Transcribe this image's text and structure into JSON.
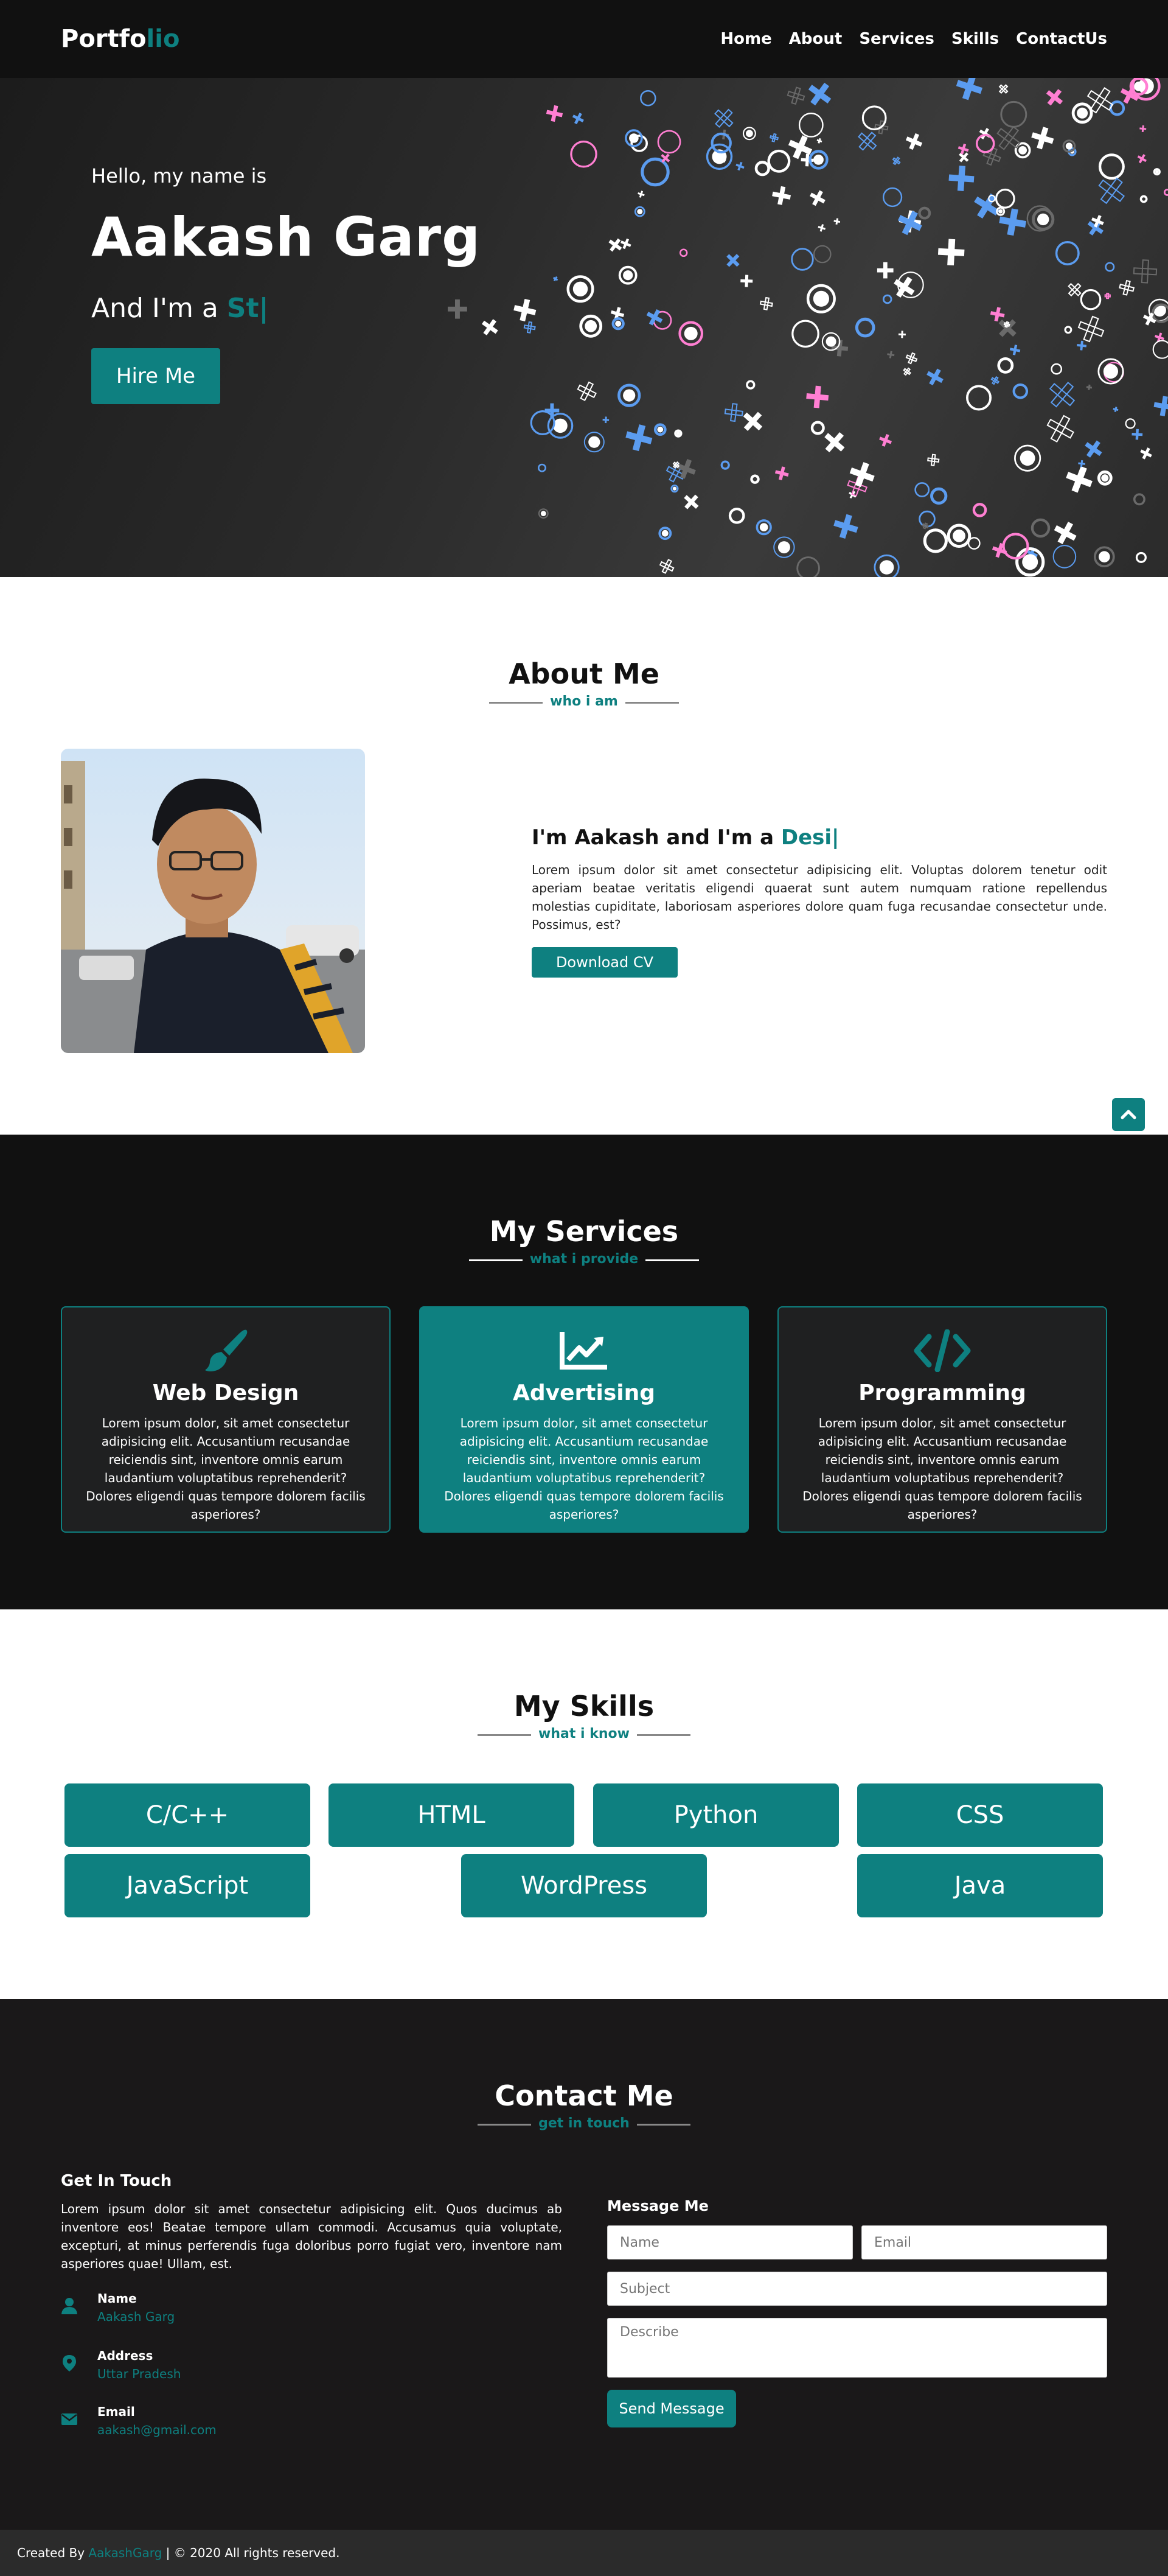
{
  "nav": {
    "logo_main": "Portfo",
    "logo_accent": "lio",
    "items": [
      "Home",
      "About",
      "Services",
      "Skills",
      "ContactUs"
    ]
  },
  "hero": {
    "greeting": "Hello, my name is",
    "name": "Aakash Garg",
    "role_prefix": "And I'm a ",
    "role_typed": "St|",
    "button": "Hire Me"
  },
  "about": {
    "title": "About Me",
    "subtitle": "who i am",
    "heading_prefix": "I'm Aakash and I'm a ",
    "heading_typed": "Desi|",
    "paragraph": "Lorem ipsum dolor sit amet consectetur adipisicing elit. Voluptas dolorem tenetur odit aperiam beatae veritatis eligendi quaerat sunt autem numquam ratione repellendus molestias cupiditate, laboriosam asperiores dolore quam fuga recusandae consectetur unde. Possimus, est?",
    "button": "Download CV"
  },
  "services": {
    "title": "My Services",
    "subtitle": "what i provide",
    "cards": [
      {
        "icon": "paint-brush-icon",
        "title": "Web Design",
        "text": "Lorem ipsum dolor, sit amet consectetur adipisicing elit. Accusantium recusandae reiciendis sint, inventore omnis earum laudantium voluptatibus reprehenderit? Dolores eligendi quas tempore dolorem facilis asperiores?"
      },
      {
        "icon": "chart-line-icon",
        "title": "Advertising",
        "text": "Lorem ipsum dolor, sit amet consectetur adipisicing elit. Accusantium recusandae reiciendis sint, inventore omnis earum laudantium voluptatibus reprehenderit? Dolores eligendi quas tempore dolorem facilis asperiores?"
      },
      {
        "icon": "code-icon",
        "title": "Programming",
        "text": "Lorem ipsum dolor, sit amet consectetur adipisicing elit. Accusantium recusandae reiciendis sint, inventore omnis earum laudantium voluptatibus reprehenderit? Dolores eligendi quas tempore dolorem facilis asperiores?"
      }
    ]
  },
  "skills": {
    "title": "My Skills",
    "subtitle": "what i know",
    "items": [
      "C/C++",
      "HTML",
      "Python",
      "CSS",
      "JavaScript",
      "WordPress",
      "Java"
    ]
  },
  "contact": {
    "title": "Contact Me",
    "subtitle": "get in touch",
    "get_in_touch_title": "Get In Touch",
    "paragraph": "Lorem ipsum dolor sit amet consectetur adipisicing elit. Quos ducimus ab inventore eos! Beatae tempore ullam commodi. Accusamus quia voluptate, excepturi, at minus perferendis fuga doloribus porro fugiat vero, inventore nam asperiores quae! Ullam, est.",
    "info": [
      {
        "icon": "user-icon",
        "label": "Name",
        "value": "Aakash Garg"
      },
      {
        "icon": "map-marker-icon",
        "label": "Address",
        "value": "Uttar Pradesh"
      },
      {
        "icon": "envelope-icon",
        "label": "Email",
        "value": "aakash@gmail.com"
      }
    ],
    "message_title": "Message Me",
    "name_placeholder": "Name",
    "email_placeholder": "Email",
    "subject_placeholder": "Subject",
    "describe_placeholder": "Describe",
    "send_button": "Send Message"
  },
  "footer": {
    "prefix": "Created By ",
    "author": "AakashGarg",
    "suffix": " | © 2020 All rights reserved."
  },
  "colors": {
    "accent": "#0e8080",
    "dark": "#111111",
    "card_dark": "#1f2021"
  }
}
